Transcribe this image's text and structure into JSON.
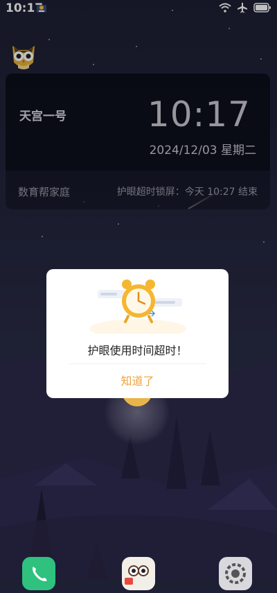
{
  "status_bar": {
    "time": "10:17",
    "icons": [
      "app-notification-icon",
      "wifi-icon",
      "airplane-icon",
      "battery-icon"
    ]
  },
  "widget": {
    "device_name": "天宫一号",
    "time": "10:17",
    "date": "2024/12/03 星期二",
    "family_label": "数育帮家庭",
    "lock_info": "护眼超时锁屏：今天 10:27 结束"
  },
  "dialog": {
    "message": "护眼使用时间超时！",
    "confirm_label": "知道了",
    "illustration_icon": "alarm-clock-icon"
  },
  "dock": {
    "icons": [
      "phone-icon",
      "owl-app-icon",
      "settings-icon"
    ]
  },
  "colors": {
    "accent": "#f0a23a",
    "background": "#24273f",
    "dock_phone": "#2ec27e"
  }
}
